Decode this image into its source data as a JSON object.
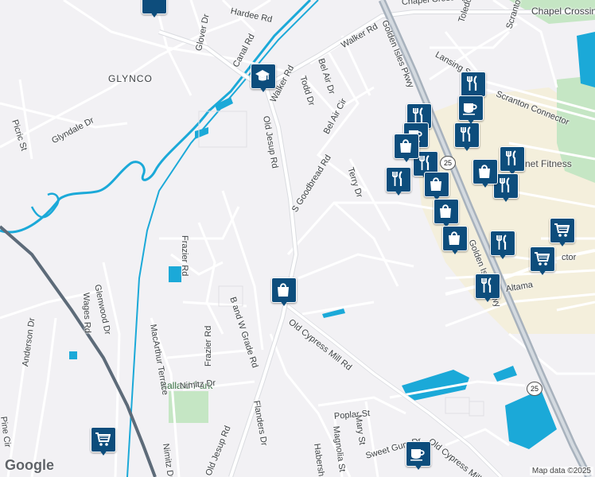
{
  "map": {
    "colors": {
      "land": "#f2f1f4",
      "road": "#ffffff",
      "highway": "#a8b2bd",
      "water": "#1ba9d8",
      "rail": "#5d6b79",
      "park": "#c5e6c4",
      "commercial": "#f4efdc",
      "pin": "#0d4d7c"
    },
    "place_labels": {
      "glynco": "GLYNCO",
      "ballard_park": "Ballard Park",
      "business": "net Fitness",
      "chapel_crossing_top": "Chapel Crossin"
    },
    "streets": {
      "chapel_crossing_rd": "Chapel Crossing Rd",
      "hardee_rd": "Hardee Rd",
      "glover_dr": "Glover Dr",
      "canal_rd": "Canal Rd",
      "walker_rd_1": "Walker Rd",
      "walker_rd_2": "Walker Rd",
      "todd_dr": "Todd Dr",
      "bel_air_dr": "Bel Air Dr",
      "bel_air_cir": "Bel Air Cir",
      "golden_isles_pkwy_1": "Golden Isles Pkwy",
      "golden_isles_pkwy_2": "Golden Isles Pkwy",
      "toledo_st": "Toledo St",
      "scranton_rd": "Scranton Rd",
      "lansing_st": "Lansing S",
      "scranton_connector": "Scranton Connector",
      "old_jesup_rd_1": "Old Jesup Rd",
      "old_jesup_rd_2": "Old Jesup Rd",
      "s_goodbread_rd": "S Goodbread Rd",
      "terry_dr": "Terry Dr",
      "glyndale_dr": "Glyndale Dr",
      "picric_st": "Picric St",
      "frazier_rd_1": "Frazier Rd",
      "frazier_rd_2": "Frazier Rd",
      "b_and_w_grade_rd": "B and W Grade Rd",
      "glenwood_dr": "Glenwood Dr",
      "wages_rd": "Wages Rd",
      "anderson_dr": "Anderson Dr",
      "macarthur_terrace": "MacArthur Terrace",
      "old_cypress_mill_rd_1": "Old Cypress Mill Rd",
      "old_cypress_mill_rd_2": "Old Cypress Mill R",
      "nimitz_dr_1": "Nimitz Dr",
      "nimitz_dr_2": "Nimitz Dr",
      "flanders_dr": "Flanders Dr",
      "poplar_st": "Poplar St",
      "magnolia_st": "Magnolia St",
      "mary_st": "Mary St",
      "sweet_gum_dr": "Sweet Gum Dr",
      "habersham": "Habersha",
      "pine_cir": "Pine Cir",
      "altama": "Altama",
      "connector": "ctor"
    },
    "shields": [
      "25",
      "25"
    ],
    "pins": [
      {
        "type": "school-icon"
      },
      {
        "type": "shopping-bag-icon"
      },
      {
        "type": "shopping-cart-icon"
      },
      {
        "type": "shopping-cart-icon"
      },
      {
        "type": "shopping-cart-icon"
      },
      {
        "type": "restaurant-icon"
      },
      {
        "type": "restaurant-icon"
      },
      {
        "type": "restaurant-icon"
      },
      {
        "type": "restaurant-icon"
      },
      {
        "type": "restaurant-icon"
      },
      {
        "type": "restaurant-icon"
      },
      {
        "type": "restaurant-icon"
      },
      {
        "type": "restaurant-icon"
      },
      {
        "type": "restaurant-icon"
      },
      {
        "type": "coffee-icon"
      },
      {
        "type": "coffee-icon"
      },
      {
        "type": "coffee-icon"
      },
      {
        "type": "shopping-bag-icon"
      },
      {
        "type": "shopping-bag-icon"
      },
      {
        "type": "shopping-bag-icon"
      },
      {
        "type": "shopping-bag-icon"
      },
      {
        "type": "shopping-bag-icon"
      }
    ],
    "logo": "Google",
    "attribution": "Map data ©2025"
  }
}
